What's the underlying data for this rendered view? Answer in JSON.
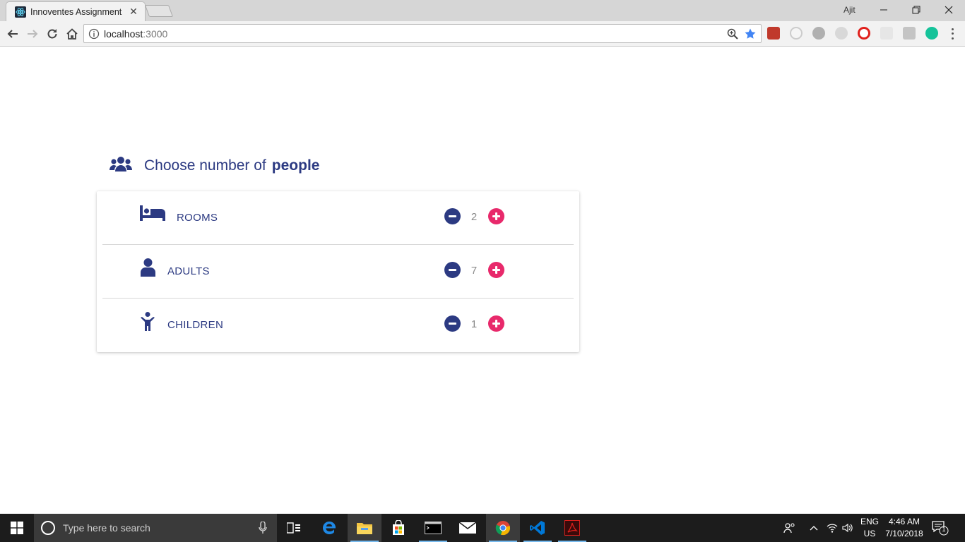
{
  "browser": {
    "tab_title": "Innoventes Assignment",
    "tab_close": "✕",
    "profile_name": "Ajit",
    "url_host": "localhost",
    "url_port": ":3000"
  },
  "page": {
    "heading_prefix": "Choose number of",
    "heading_bold": "people",
    "rows": [
      {
        "label": "ROOMS",
        "count": "2",
        "icon": "bed-icon"
      },
      {
        "label": "ADULTS",
        "count": "7",
        "icon": "person-icon"
      },
      {
        "label": "CHILDREN",
        "count": "1",
        "icon": "child-icon"
      }
    ]
  },
  "taskbar": {
    "search_placeholder": "Type here to search",
    "lang_top": "ENG",
    "lang_bottom": "US",
    "time": "4:46 AM",
    "date": "7/10/2018",
    "notification_count": "1"
  },
  "colors": {
    "primary": "#2c3a82",
    "accent": "#e8296b"
  }
}
